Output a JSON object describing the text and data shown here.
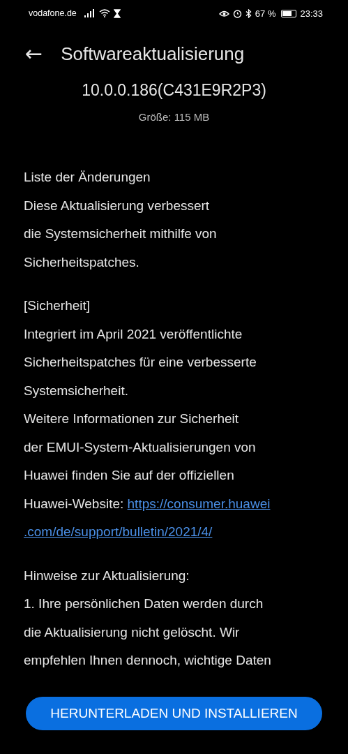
{
  "status_bar": {
    "carrier": "vodafone.de",
    "battery_percent": "67 %",
    "time": "23:33"
  },
  "header": {
    "back": "←",
    "title": "Softwareaktualisierung"
  },
  "version": "10.0.0.186(C431E9R2P3)",
  "size": "Größe: 115 MB",
  "sections": [
    {
      "blocks": [
        {
          "kind": "heading",
          "lines": [
            "Liste der Änderungen"
          ]
        },
        {
          "kind": "text",
          "lines": [
            "Diese Aktualisierung verbessert",
            "die Systemsicherheit mithilfe von",
            "Sicherheitspatches."
          ]
        }
      ]
    },
    {
      "blocks": [
        {
          "kind": "heading",
          "lines": [
            "[Sicherheit]"
          ]
        },
        {
          "kind": "text",
          "lines": [
            "Integriert im April 2021 veröffentlichte",
            "Sicherheitspatches für eine verbesserte",
            "Systemsicherheit."
          ]
        },
        {
          "kind": "text",
          "lines": [
            "Weitere Informationen zur Sicherheit",
            "der EMUI-System-Aktualisierungen von",
            "Huawei finden Sie auf der offiziellen",
            "Huawei-Website: "
          ],
          "link": [
            "https://consumer.huawei",
            ".com/de/support/bulletin/2021/4/"
          ]
        }
      ]
    },
    {
      "blocks": [
        {
          "kind": "heading",
          "lines": [
            "Hinweise zur Aktualisierung:"
          ]
        },
        {
          "kind": "text",
          "lines": [
            "1. Ihre persönlichen Daten werden durch",
            "die Aktualisierung nicht gelöscht. Wir",
            "empfehlen Ihnen dennoch, wichtige Daten"
          ]
        }
      ]
    }
  ],
  "button": "HERUNTERLADEN UND INSTALLIEREN"
}
